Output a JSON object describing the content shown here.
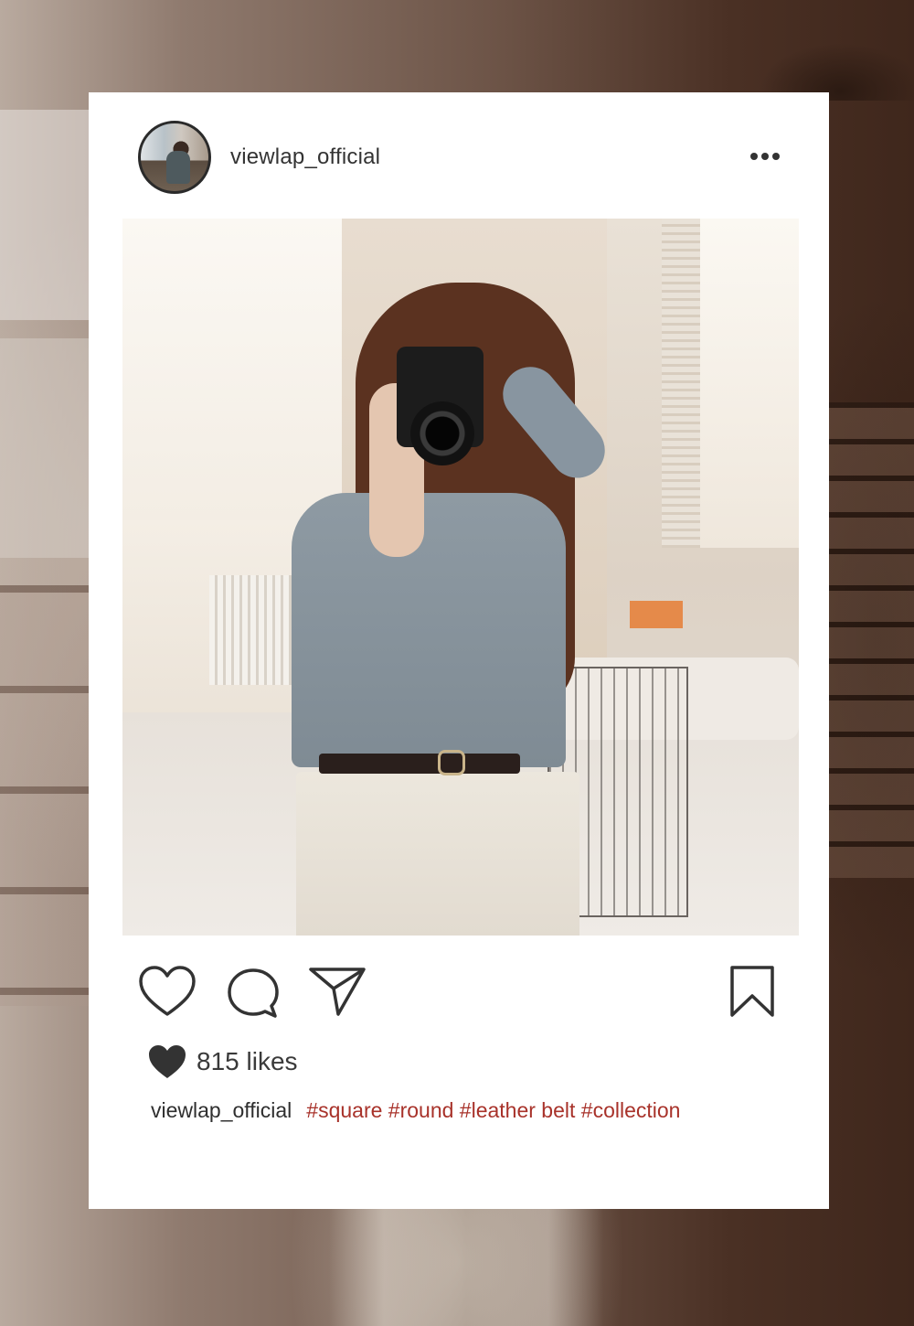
{
  "post": {
    "username": "viewlap_official",
    "more_menu": "more-options",
    "likes": {
      "count": "815",
      "unit": "likes"
    },
    "caption": {
      "username": "viewlap_official",
      "hashtags": "#square #round #leather belt #collection"
    },
    "actions": [
      "like",
      "comment",
      "share",
      "save"
    ]
  },
  "colors": {
    "card_background": "#ffffff",
    "text": "#333333",
    "hashtag": "#a8322a",
    "backdrop": "#5a3e30"
  },
  "icons": {
    "heart": "heart-outline-icon",
    "comment": "comment-bubble-icon",
    "share": "paper-plane-icon",
    "bookmark": "bookmark-outline-icon",
    "likes": "heart-filled-icon",
    "more": "ellipsis-icon"
  }
}
